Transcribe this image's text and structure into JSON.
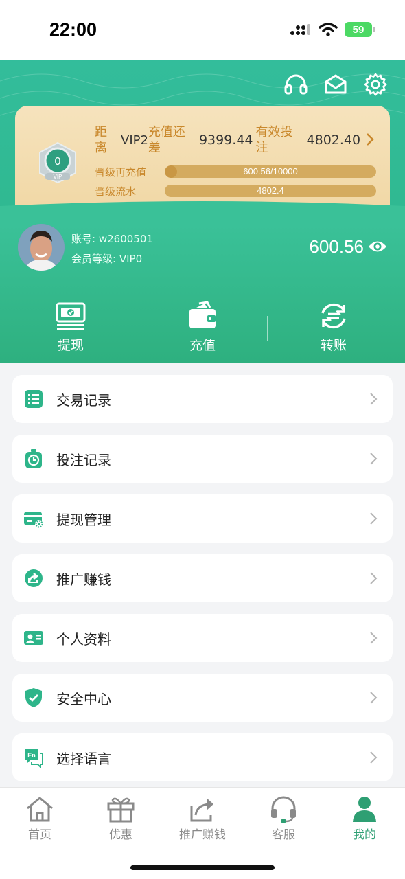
{
  "status_bar": {
    "time": "22:00",
    "battery": "59"
  },
  "header": {
    "icons": [
      "headset-icon",
      "mail-icon",
      "gear-icon"
    ],
    "vip_card": {
      "badge_level": "0",
      "badge_text": "VIP",
      "distance_label": "距离",
      "target_level": "VIP2",
      "recharge_remaining_label": "充值还差",
      "recharge_remaining_value": "9399.44",
      "valid_bet_label": "有效投注",
      "valid_bet_value": "4802.40",
      "progress": [
        {
          "label": "晋级再充值",
          "text": "600.56/10000",
          "fraction": 0.06
        },
        {
          "label": "晋级流水",
          "text": "4802.4",
          "fraction": 0.0
        }
      ]
    },
    "profile": {
      "account_label": "账号:",
      "account_value": "w2600501",
      "level_label": "会员等级:",
      "level_value": "VIP0",
      "balance": "600.56"
    },
    "actions": [
      {
        "label": "提现",
        "icon": "withdraw-icon"
      },
      {
        "label": "充值",
        "icon": "wallet-icon"
      },
      {
        "label": "转账",
        "icon": "transfer-icon"
      }
    ]
  },
  "menu": [
    {
      "label": "交易记录",
      "icon": "list-icon"
    },
    {
      "label": "投注记录",
      "icon": "timer-icon"
    },
    {
      "label": "提现管理",
      "icon": "card-settings-icon"
    },
    {
      "label": "推广赚钱",
      "icon": "share-icon"
    },
    {
      "label": "个人资料",
      "icon": "id-card-icon"
    },
    {
      "label": "安全中心",
      "icon": "shield-icon"
    },
    {
      "label": "选择语言",
      "icon": "language-icon"
    }
  ],
  "tabbar": [
    {
      "label": "首页",
      "icon": "home-icon",
      "active": false
    },
    {
      "label": "优惠",
      "icon": "gift-icon",
      "active": false
    },
    {
      "label": "推广赚钱",
      "icon": "share-icon",
      "active": false
    },
    {
      "label": "客服",
      "icon": "headset-icon",
      "active": false
    },
    {
      "label": "我的",
      "icon": "user-icon",
      "active": true
    }
  ],
  "colors": {
    "brand_green": "#2eb58a",
    "gold": "#c9882c",
    "active_tab": "#2e9f73"
  }
}
